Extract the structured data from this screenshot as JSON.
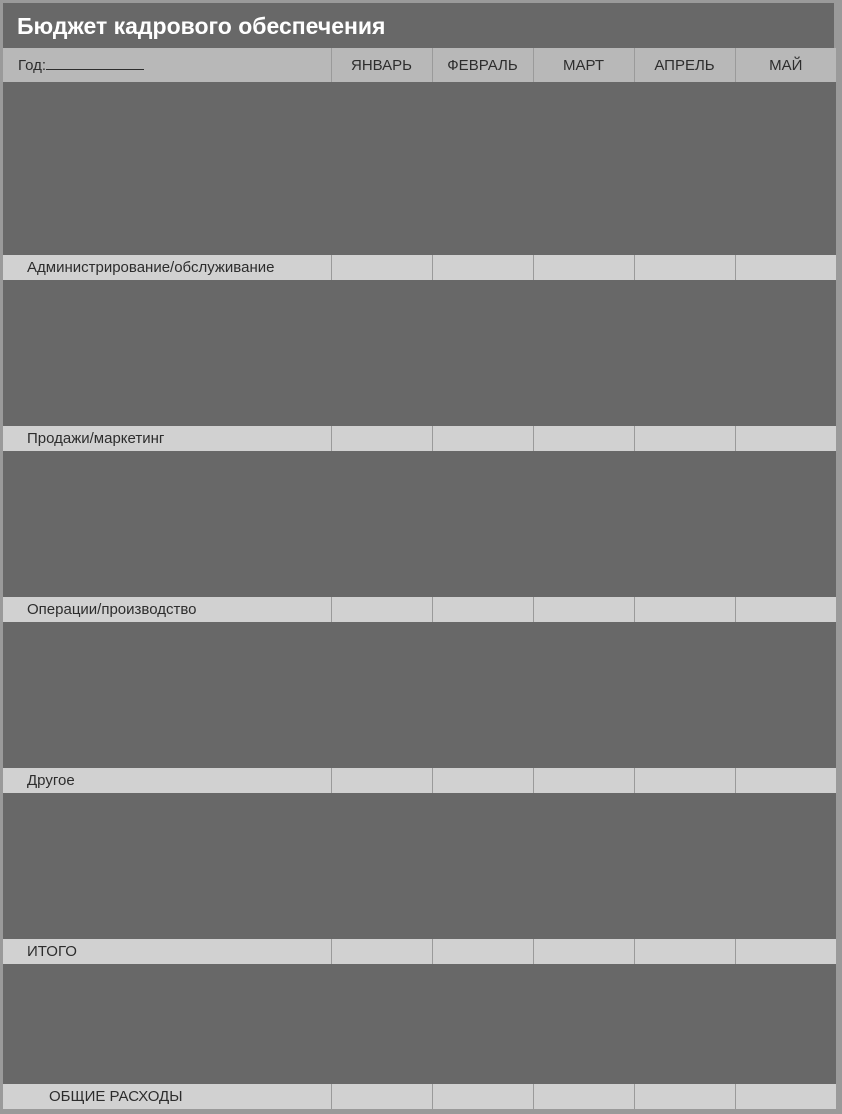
{
  "title": "Бюджет кадрового обеспечения",
  "header": {
    "year_label": "Год:",
    "months": [
      "ЯНВАРЬ",
      "ФЕВРАЛЬ",
      "МАРТ",
      "АПРЕЛЬ",
      "МАЙ"
    ]
  },
  "sections": [
    {
      "label": "Администрирование/обслуживание"
    },
    {
      "label": "Продажи/маркетинг"
    },
    {
      "label": "Операции/производство"
    },
    {
      "label": "Другое"
    },
    {
      "label": "ИТОГО"
    },
    {
      "label": "ОБЩИЕ РАСХОДЫ"
    }
  ]
}
